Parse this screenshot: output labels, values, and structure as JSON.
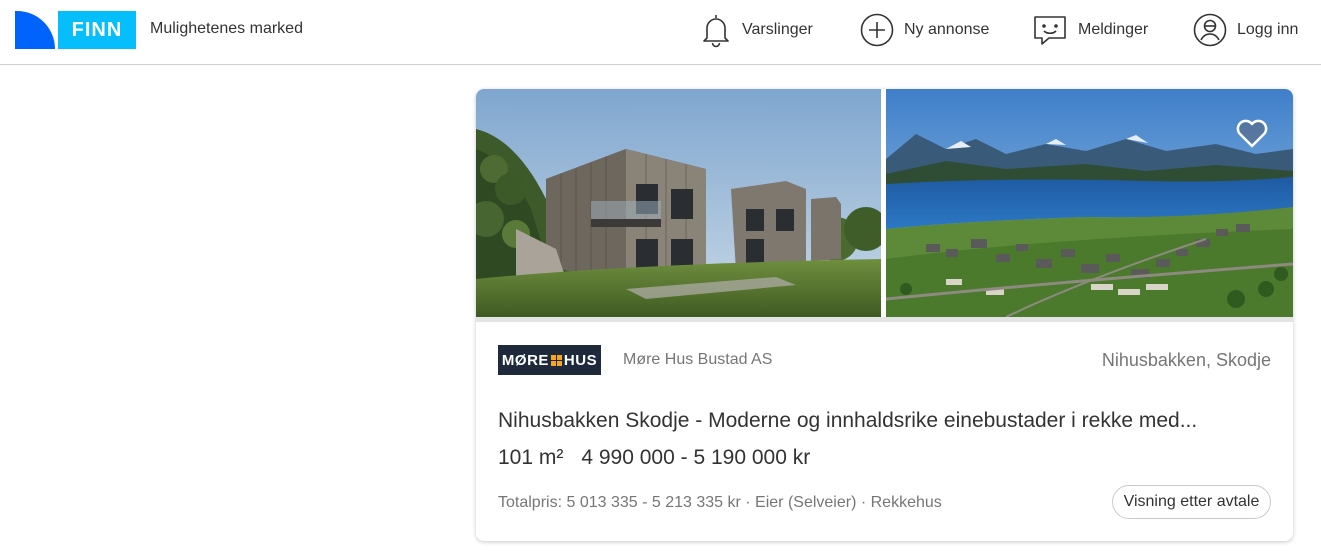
{
  "header": {
    "logo_text": "FINN",
    "tagline": "Mulighetenes marked",
    "nav": [
      {
        "label": "Varslinger",
        "icon": "bell-icon"
      },
      {
        "label": "Ny annonse",
        "icon": "plus-circle-icon"
      },
      {
        "label": "Meldinger",
        "icon": "chat-icon"
      },
      {
        "label": "Logg inn",
        "icon": "user-icon"
      }
    ]
  },
  "listing": {
    "brand_logo": {
      "left": "MØRE",
      "right": "HUS"
    },
    "company": "Møre Hus Bustad AS",
    "location": "Nihusbakken, Skodje",
    "title": "Nihusbakken Skodje - Moderne og innhaldsrike einebustader i rekke med...",
    "area": "101 m²",
    "price": "4 990 000 - 5 190 000 kr",
    "details": "Totalpris: 5 013 335 - 5 213 335 kr · Eier (Selveier) · Rekkehus",
    "viewing_button": "Visning etter avtale",
    "images": [
      "house-render-image",
      "aerial-fjord-image"
    ]
  },
  "colors": {
    "finn_blue": "#0063fb",
    "finn_light_blue": "#06befb",
    "brand_navy": "#1e2a3c"
  }
}
